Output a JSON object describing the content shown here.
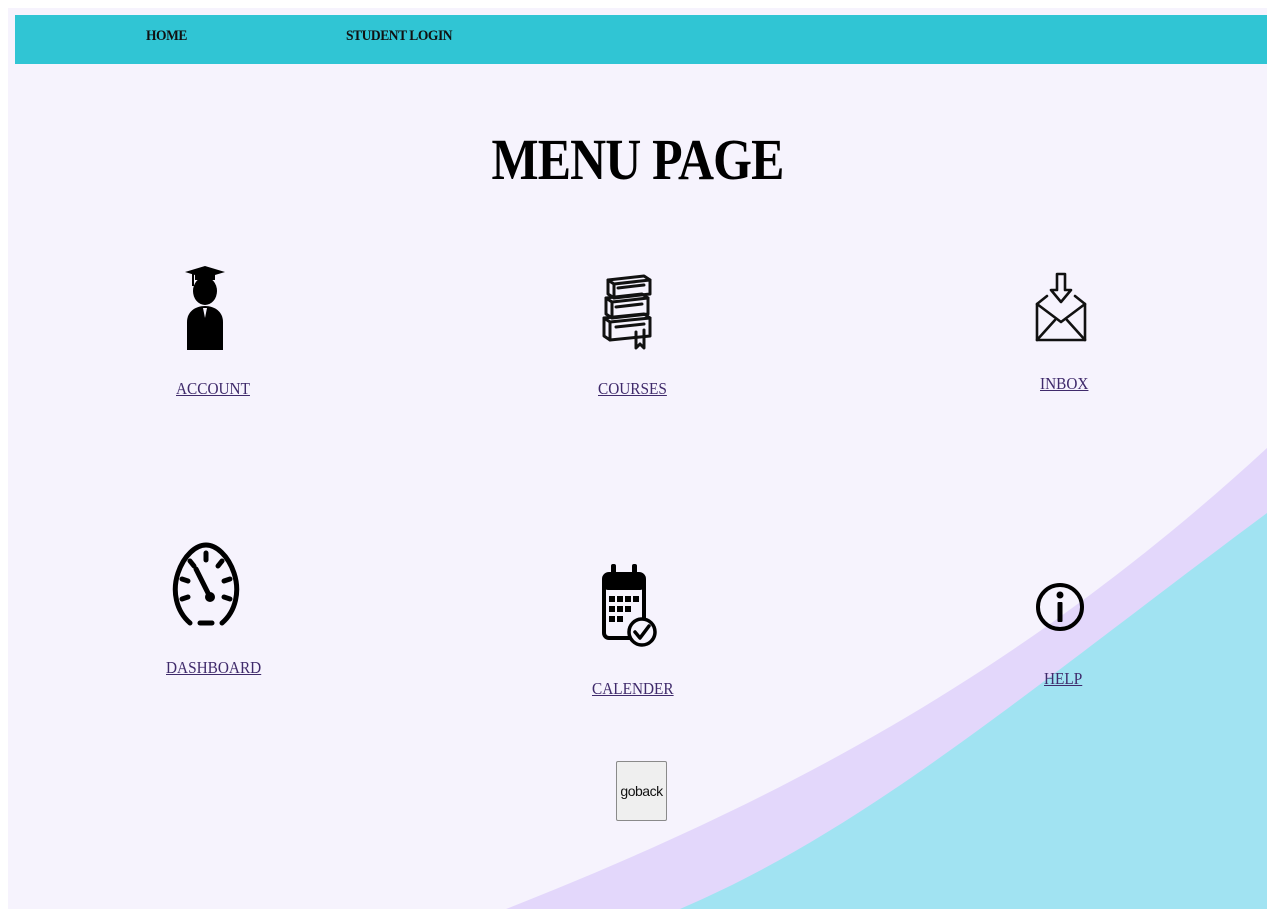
{
  "nav": {
    "home_label": "HOME",
    "student_login_label": "STUDENT LOGIN"
  },
  "page_title": "MENU PAGE",
  "menu": {
    "account_label": "ACCOUNT",
    "courses_label": "COURSES",
    "inbox_label": "INBOX",
    "dashboard_label": "DASHBOARD",
    "calender_label": "CALENDER",
    "help_label": "HELP"
  },
  "goback_label": "goback",
  "icons": {
    "account": "graduate-student-icon",
    "courses": "books-stack-icon",
    "inbox": "inbox-envelope-icon",
    "dashboard": "speedometer-icon",
    "calender": "calendar-check-icon",
    "help": "info-circle-icon"
  },
  "colors": {
    "navbar": "#30c5d4",
    "background": "#f6f3fd",
    "wave_lavender": "#e3d7fb",
    "wave_cyan": "#a1e3f2",
    "link": "#3f2a6b"
  }
}
